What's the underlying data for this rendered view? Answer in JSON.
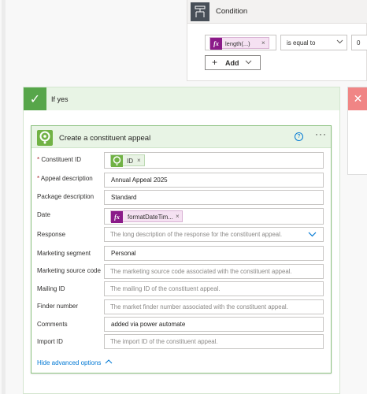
{
  "condition": {
    "title": "Condition",
    "token_label": "length(...)",
    "operator": "is equal to",
    "value": "0",
    "add_label": "Add"
  },
  "if_yes": {
    "title": "If yes"
  },
  "action": {
    "title": "Create a constituent appeal",
    "help": "?",
    "more": "···",
    "fields": {
      "constituent_id": {
        "label": "Constituent ID",
        "token": "ID"
      },
      "appeal_description": {
        "label": "Appeal description",
        "value": "Annual Appeal 2025"
      },
      "package_description": {
        "label": "Package description",
        "value": "Standard"
      },
      "date": {
        "label": "Date",
        "token": "formatDateTim..."
      },
      "response": {
        "label": "Response",
        "placeholder": "The long description of the response for the constituent appeal."
      },
      "marketing_segment": {
        "label": "Marketing segment",
        "value": "Personal"
      },
      "marketing_source_code": {
        "label": "Marketing source code",
        "placeholder": "The marketing source code associated with the constituent appeal."
      },
      "mailing_id": {
        "label": "Mailing ID",
        "placeholder": "The mailing ID of the constituent appeal."
      },
      "finder_number": {
        "label": "Finder number",
        "placeholder": "The market finder number associated with the constituent appeal."
      },
      "comments": {
        "label": "Comments",
        "value": "added via power automate"
      },
      "import_id": {
        "label": "Import ID",
        "placeholder": "The import ID of the constituent appeal."
      }
    },
    "hide_advanced": "Hide advanced options"
  },
  "colors": {
    "accent": "#0078d4",
    "success": "#57a64a",
    "danger": "#f08585",
    "expression": "#8b1a89"
  }
}
